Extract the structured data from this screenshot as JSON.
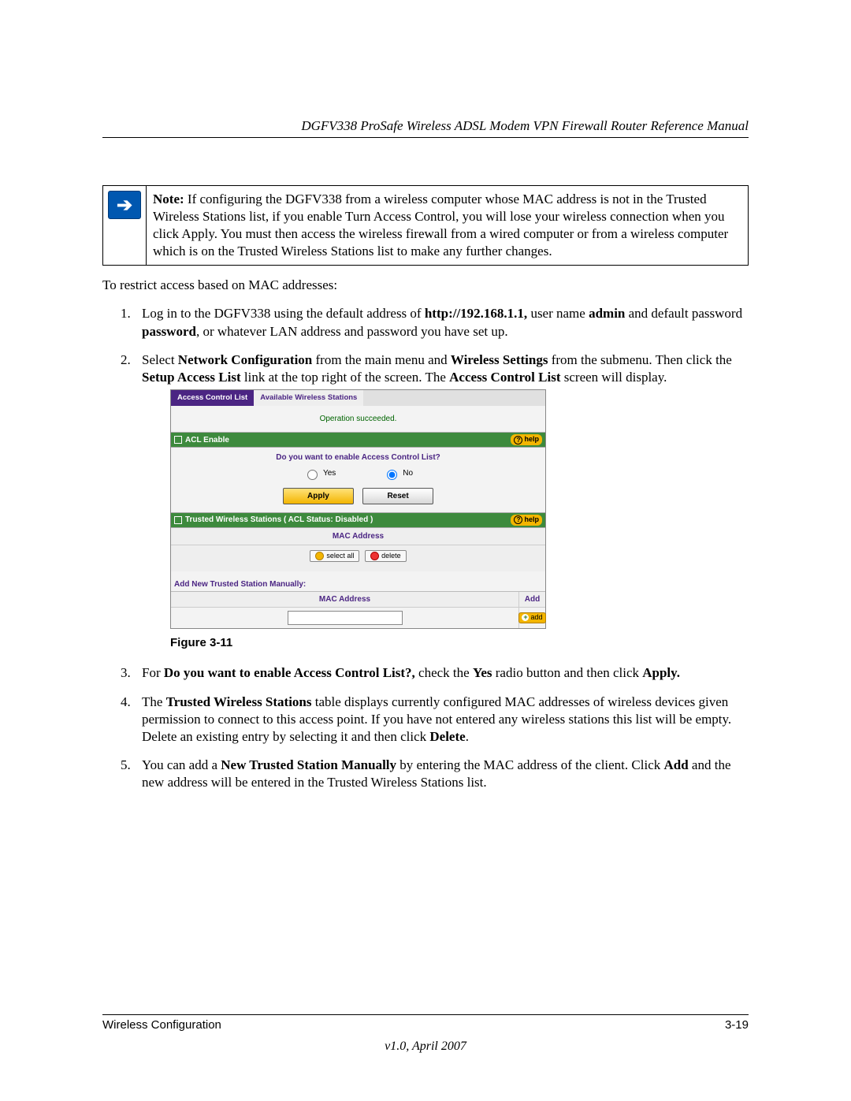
{
  "header": {
    "title": "DGFV338 ProSafe Wireless ADSL Modem VPN Firewall Router Reference Manual"
  },
  "note": {
    "label": "Note:",
    "text": "If configuring the DGFV338 from a wireless computer whose MAC address is not in the Trusted Wireless Stations list, if you enable Turn Access Control, you will lose your wireless connection when you click Apply. You must then access the wireless firewall from a wired computer or from a wireless computer which is on the Trusted Wireless Stations list to make any further changes."
  },
  "intro": "To restrict access based on MAC addresses:",
  "steps": {
    "s1a": "Log in to the DGFV338 using the default address of ",
    "s1_url": "http://192.168.1.1,",
    "s1b": " user name ",
    "s1_user": "admin",
    "s1c": " and default password ",
    "s1_pw": "password",
    "s1d": ", or whatever LAN address and password you have set up.",
    "s2a": "Select ",
    "s2_nc": "Network Configuration",
    "s2b": " from the main menu and ",
    "s2_ws": "Wireless Settings",
    "s2c": " from the submenu. Then click the ",
    "s2_sal": "Setup Access List",
    "s2d": " link at the top right of the screen. The ",
    "s2_acl": "Access Control List",
    "s2e": " screen will display.",
    "s3a": "For ",
    "s3_q": "Do you want to enable Access Control List?,",
    "s3b": " check the ",
    "s3_yes": "Yes",
    "s3c": " radio button and then click ",
    "s3_apply": "Apply.",
    "s4a": "The ",
    "s4_tws": "Trusted Wireless Stations",
    "s4b": " table displays currently configured MAC addresses of wireless devices given permission to connect to this access point. If you have not entered any wireless stations this list will be empty. Delete an existing entry by selecting it and then click ",
    "s4_del": "Delete",
    "s4c": ".",
    "s5a": "You can add a ",
    "s5_ntsm": "New Trusted Station Manually",
    "s5b": " by entering the MAC address of the client. Click ",
    "s5_add": "Add",
    "s5c": " and the new address will be entered in the Trusted Wireless Stations list."
  },
  "screenshot": {
    "tabs": {
      "active": "Access Control List",
      "inactive": "Available Wireless Stations"
    },
    "status": "Operation succeeded.",
    "sec1_title": "ACL Enable",
    "help": "help",
    "question": "Do you want to enable Access Control List?",
    "yes": "Yes",
    "no": "No",
    "apply": "Apply",
    "reset": "Reset",
    "sec2_title": "Trusted Wireless Stations ( ACL Status: Disabled )",
    "mac_header": "MAC Address",
    "select_all": "select all",
    "delete": "delete",
    "manual_caption": "Add New Trusted Station Manually:",
    "add_header": "Add",
    "add_btn": "add"
  },
  "figure_caption": "Figure 3-11",
  "footer": {
    "left": "Wireless Configuration",
    "right": "3-19",
    "version": "v1.0, April 2007"
  }
}
